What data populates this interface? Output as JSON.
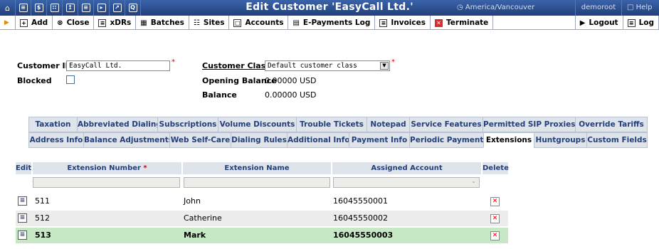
{
  "titlebar": {
    "title": "Edit Customer 'EasyCall Ltd.'",
    "timezone": "America/Vancouver",
    "timezone_icon": "clock-icon",
    "user": "demoroot",
    "help": "Help",
    "icons": [
      "home-icon",
      "list-icon",
      "dollar-icon",
      "grid-icon",
      "upload-icon",
      "rates-icon",
      "forward-icon",
      "chart-icon",
      "search-icon"
    ]
  },
  "toolbar": {
    "add": "Add",
    "close": "Close",
    "xdrs": "xDRs",
    "batches": "Batches",
    "sites": "Sites",
    "accounts": "Accounts",
    "epayments": "E-Payments Log",
    "invoices": "Invoices",
    "terminate": "Terminate",
    "logout": "Logout",
    "log": "Log"
  },
  "form": {
    "customer_id_label": "Customer ID",
    "customer_id_value": "EasyCall Ltd.",
    "blocked_label": "Blocked",
    "blocked_checked": false,
    "customer_class_label": "Customer Class",
    "customer_class_value": "Default customer class",
    "opening_balance_label": "Opening Balance",
    "opening_balance_value": "0.00000 USD",
    "balance_label": "Balance",
    "balance_value": "0.00000 USD",
    "required_mark": "*"
  },
  "tabs": {
    "row1": [
      "Taxation",
      "Abbreviated Dialing",
      "Subscriptions",
      "Volume Discounts",
      "Trouble Tickets",
      "Notepad",
      "Service Features",
      "Permitted SIP Proxies",
      "Override Tariffs"
    ],
    "row2": [
      "Address Info",
      "Balance Adjustments",
      "Web Self-Care",
      "Dialing Rules",
      "Additional Info",
      "Payment Info",
      "Periodic Payments",
      "Extensions",
      "Huntgroups",
      "Custom Fields"
    ],
    "active": "Extensions"
  },
  "table": {
    "headers": {
      "edit": "Edit",
      "extension_number": "Extension Number",
      "extension_name": "Extension Name",
      "assigned_account": "Assigned Account",
      "delete": "Delete"
    },
    "rows": [
      {
        "number": "511",
        "name": "John",
        "account": "16045550001",
        "highlight": false
      },
      {
        "number": "512",
        "name": "Catherine",
        "account": "16045550002",
        "highlight": false
      },
      {
        "number": "513",
        "name": "Mark",
        "account": "16045550003",
        "highlight": true
      }
    ]
  },
  "colors": {
    "titlebar": "#223f7a",
    "tab_text": "#24407a",
    "row_alt": "#ececec",
    "row_highlight": "#c7e8c4",
    "delete_red": "#dd0000"
  }
}
